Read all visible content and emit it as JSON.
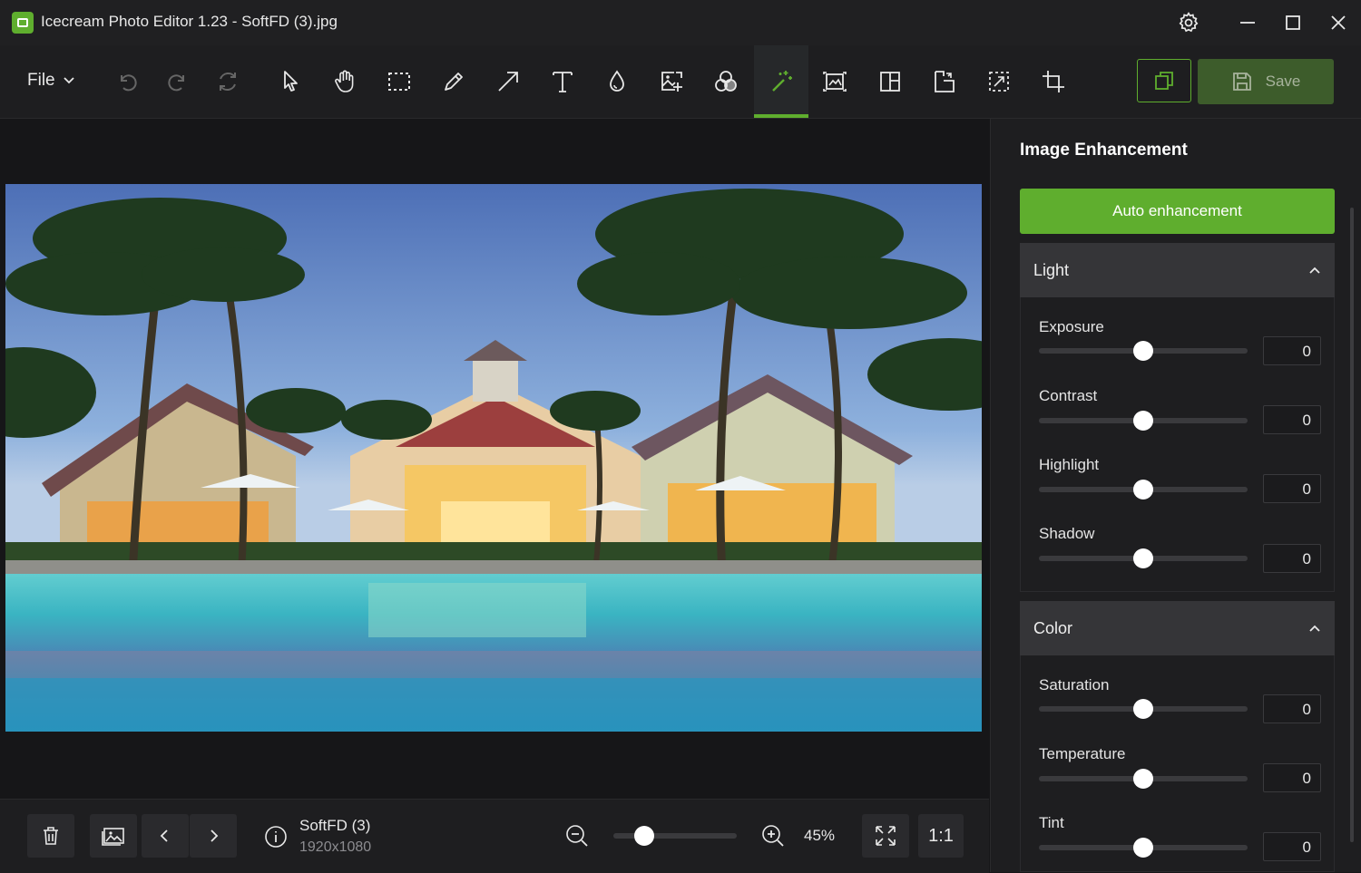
{
  "window": {
    "title": "Icecream Photo Editor 1.23 - SoftFD (3).jpg",
    "controls": [
      "settings-icon",
      "minimize-icon",
      "maximize-icon",
      "close-icon"
    ]
  },
  "toolbar": {
    "file_label": "File",
    "save_label": "Save",
    "tools": [
      {
        "id": "undo",
        "icon": "undo-icon",
        "enabled": false
      },
      {
        "id": "redo",
        "icon": "redo-icon",
        "enabled": false
      },
      {
        "id": "reset",
        "icon": "reset-icon",
        "enabled": false
      },
      {
        "id": "select",
        "icon": "cursor-icon"
      },
      {
        "id": "hand",
        "icon": "hand-icon"
      },
      {
        "id": "marquee",
        "icon": "marquee-icon"
      },
      {
        "id": "pencil",
        "icon": "pencil-icon"
      },
      {
        "id": "arrow",
        "icon": "arrow-icon"
      },
      {
        "id": "text",
        "icon": "text-icon"
      },
      {
        "id": "blur",
        "icon": "drop-icon"
      },
      {
        "id": "add-image",
        "icon": "add-image-icon"
      },
      {
        "id": "filters",
        "icon": "filters-icon"
      },
      {
        "id": "enhance",
        "icon": "magic-wand-icon",
        "active": true
      },
      {
        "id": "resize",
        "icon": "resize-icon"
      },
      {
        "id": "collage",
        "icon": "collage-icon"
      },
      {
        "id": "rotate",
        "icon": "rotate-icon"
      },
      {
        "id": "crop-select",
        "icon": "crop-select-icon"
      },
      {
        "id": "crop",
        "icon": "crop-icon"
      }
    ]
  },
  "panel": {
    "title": "Image Enhancement",
    "auto_button": "Auto enhancement",
    "light": {
      "label": "Light",
      "sliders": [
        {
          "name": "Exposure",
          "value": "0",
          "level": 0.5
        },
        {
          "name": "Contrast",
          "value": "0",
          "level": 0.5
        },
        {
          "name": "Highlight",
          "value": "0",
          "level": 0.5
        },
        {
          "name": "Shadow",
          "value": "0",
          "level": 0.5
        }
      ]
    },
    "color": {
      "label": "Color",
      "sliders": [
        {
          "name": "Saturation",
          "value": "0",
          "level": 0.5
        },
        {
          "name": "Temperature",
          "value": "0",
          "level": 0.5
        },
        {
          "name": "Tint",
          "value": "0",
          "level": 0.5
        }
      ]
    }
  },
  "bottom": {
    "file_name": "SoftFD (3)",
    "dimensions": "1920x1080",
    "zoom_percent": "45%",
    "zoom_level": 0.25,
    "one_to_one": "1:1"
  }
}
